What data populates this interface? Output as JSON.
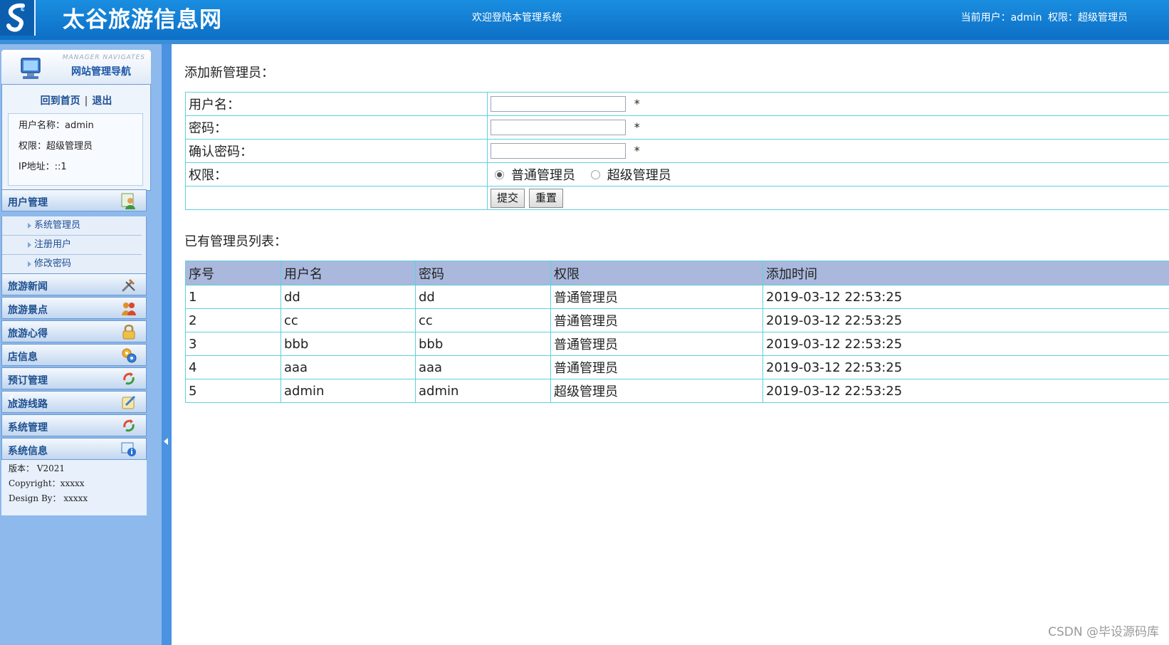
{
  "header": {
    "title": "太谷旅游信息网",
    "welcome": "欢迎登陆本管理系统",
    "current_user": "当前用户：admin",
    "current_role": "权限：超级管理员"
  },
  "sidebar": {
    "nav_title_en": "MANAGER NAVIGATES",
    "nav_title": "网站管理导航",
    "home_link": "回到首页",
    "link_separator": "|",
    "logout_link": "退出",
    "user_name": "用户名称：admin",
    "user_role": "权限：超级管理员",
    "user_ip": "IP地址：::1",
    "menus": [
      {
        "label": "用户管理",
        "icon": "user-group-icon"
      },
      {
        "label": "旅游新闻",
        "icon": "tools-icon"
      },
      {
        "label": "旅游景点",
        "icon": "people-icon"
      },
      {
        "label": "旅游心得",
        "icon": "lock-icon"
      },
      {
        "label": "店信息",
        "icon": "gears-icon"
      },
      {
        "label": "预订管理",
        "icon": "refresh-icon"
      },
      {
        "label": "旅游线路",
        "icon": "edit-icon"
      },
      {
        "label": "系统管理",
        "icon": "refresh-icon"
      },
      {
        "label": "系统信息",
        "icon": "info-icon"
      }
    ],
    "submenu": [
      "系统管理员",
      "注册用户",
      "修改密码"
    ],
    "version": "版本：  V2021",
    "copyright": "Copyright：xxxxx",
    "design": "Design By：  xxxxx"
  },
  "form": {
    "title": "添加新管理员：",
    "username_label": "用户名：",
    "password_label": "密码：",
    "confirm_label": "确认密码：",
    "role_label": "权限：",
    "required_mark": "*",
    "role_options": [
      "普通管理员",
      "超级管理员"
    ],
    "role_selected": "普通管理员",
    "submit": "提交",
    "reset": "重置"
  },
  "list": {
    "title": "已有管理员列表：",
    "columns": [
      "序号",
      "用户名",
      "密码",
      "权限",
      "添加时间"
    ],
    "rows": [
      [
        "1",
        "dd",
        "dd",
        "普通管理员",
        "2019-03-12 22:53:25"
      ],
      [
        "2",
        "cc",
        "cc",
        "普通管理员",
        "2019-03-12 22:53:25"
      ],
      [
        "3",
        "bbb",
        "bbb",
        "普通管理员",
        "2019-03-12 22:53:25"
      ],
      [
        "4",
        "aaa",
        "aaa",
        "普通管理员",
        "2019-03-12 22:53:25"
      ],
      [
        "5",
        "admin",
        "admin",
        "超级管理员",
        "2019-03-12 22:53:25"
      ]
    ]
  },
  "watermark": "CSDN @毕设源码库",
  "colors": {
    "header_blue": "#1a8ee0",
    "sidebar_blue": "#8db9ec",
    "table_border": "#5fd0e0",
    "table_header": "#a9b8dc"
  }
}
